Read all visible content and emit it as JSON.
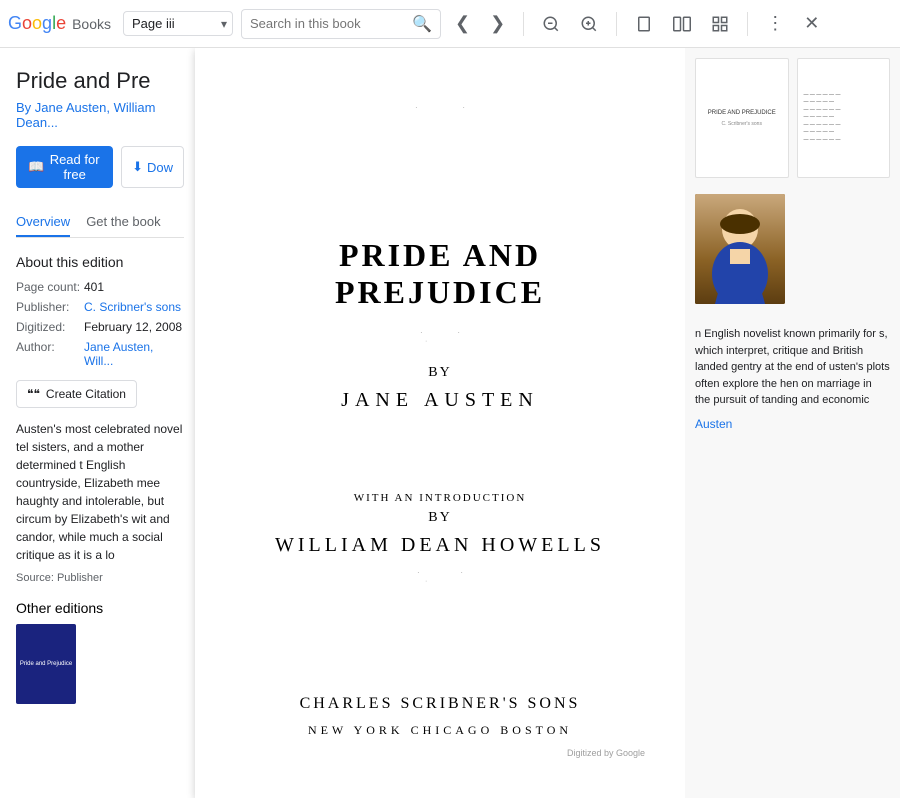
{
  "toolbar": {
    "logo": {
      "google": "Google",
      "books": "Books"
    },
    "page_input": {
      "value": "Page iii",
      "placeholder": "Page"
    },
    "search": {
      "placeholder": "Search in this book",
      "value": ""
    },
    "icons": {
      "prev": "❮",
      "next": "❯",
      "zoom_in": "🔍",
      "zoom_out": "🔍",
      "single_page": "▬",
      "double_page": "▬▬",
      "grid": "⊞",
      "more": "⋮",
      "close": "✕"
    }
  },
  "left_panel": {
    "book_title": "Pride and Pre",
    "book_author": "By Jane Austen, William Dean...",
    "read_free_label": "Read for free",
    "download_label": "Dow",
    "tabs": [
      {
        "label": "Overview",
        "active": true
      },
      {
        "label": "Get the book",
        "active": false
      }
    ],
    "about_edition": {
      "title": "About this edition",
      "fields": [
        {
          "label": "Page count:",
          "value": "401",
          "is_link": false
        },
        {
          "label": "Publisher:",
          "value": "C. Scribner's sons",
          "is_link": true
        },
        {
          "label": "Digitized:",
          "value": "February 12, 2008",
          "is_link": false
        },
        {
          "label": "Author:",
          "value": "Jane Austen, Will...",
          "is_link": true
        }
      ]
    },
    "create_citation_label": "Create Citation",
    "description": "Austen's most celebrated novel tel sisters, and a mother determined t English countryside, Elizabeth mee haughty and intolerable, but circum by Elizabeth's wit and candor, while much a social critique as it is a lo",
    "source": "Source: Publisher",
    "other_editions_title": "Other editions",
    "edition_thumb_title": "Pride and Prejudice"
  },
  "book_page": {
    "title": "PRIDE AND PREJUDICE",
    "by_label": "BY",
    "author": "JANE AUSTEN",
    "intro_label": "WITH AN INTRODUCTION",
    "intro_by": "BY",
    "intro_author": "WILLIAM DEAN HOWELLS",
    "publisher": "CHARLES SCRIBNER'S SONS",
    "cities": "NEW YORK     CHICAGO     BOSTON",
    "digitized_by": "Digitized by Google"
  },
  "right_panel": {
    "thumbs": [
      {
        "text": "PRIDE AND PREJUDICE\n\nC. Scribner's sons"
      },
      {
        "text": "page content lines..."
      }
    ],
    "portrait_alt": "Jane Austen portrait",
    "description_lines": "n English novelist known primarily for s, which interpret, critique and British landed gentry at the end of usten's plots often explore the hen on marriage in the pursuit of tanding and economic",
    "author_name": "Austen"
  }
}
